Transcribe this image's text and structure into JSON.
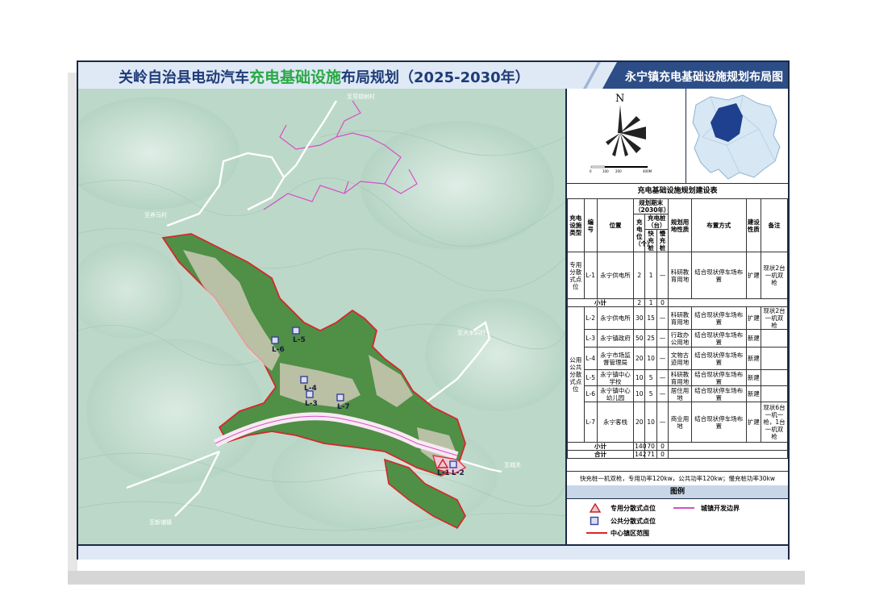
{
  "header": {
    "title_pre": "关岭自治县电动汽车",
    "title_highlight": "充电基础设施",
    "title_post": "布局规划（2025-2030年）",
    "subtitle": "永宁镇充电基础设施规划布局图"
  },
  "map": {
    "road_labels": [
      "至弯德树村",
      "至养马村",
      "至大水洞村",
      "至城关",
      "至新铺镇"
    ],
    "points": [
      "L-1",
      "L-2",
      "L-3",
      "L-4",
      "L-5",
      "L-6",
      "L-7"
    ]
  },
  "compass": {
    "north": "N",
    "scale": [
      "0",
      "100",
      "200",
      "400M"
    ]
  },
  "table": {
    "title": "充电基础设施规划建设表",
    "headers": {
      "type": "充电设施类型",
      "id": "编号",
      "location": "位置",
      "period": "规划期末（2030年）",
      "spaces": "充电位（个）",
      "piles": "充电桩（台）",
      "fast": "快充桩",
      "slow": "慢充桩",
      "land": "规划用地性质",
      "layout": "布置方式",
      "nature": "建设性质",
      "remark": "备注"
    },
    "group1": {
      "type": "专用分散式点位",
      "rows": [
        {
          "id": "L-1",
          "location": "永宁供电所",
          "spaces": "2",
          "fast": "1",
          "slow": "—",
          "land": "科研教育用地",
          "layout": "结合现状停车场布置",
          "nature": "扩建",
          "remark": "现状2台一机双枪"
        }
      ],
      "subtotal": {
        "label": "小计",
        "spaces": "2",
        "fast": "1",
        "slow": "0"
      }
    },
    "group2": {
      "type": "公用公共分散式点位",
      "rows": [
        {
          "id": "L-2",
          "location": "永宁供电所",
          "spaces": "30",
          "fast": "15",
          "slow": "—",
          "land": "科研教育用地",
          "layout": "结合现状停车场布置",
          "nature": "扩建",
          "remark": "现状2台一机双枪"
        },
        {
          "id": "L-3",
          "location": "永宁镇政府",
          "spaces": "50",
          "fast": "25",
          "slow": "—",
          "land": "行政办公用地",
          "layout": "结合现状停车场布置",
          "nature": "新建",
          "remark": ""
        },
        {
          "id": "L-4",
          "location": "永宁市场监督管理局",
          "spaces": "20",
          "fast": "10",
          "slow": "—",
          "land": "文物古迹用地",
          "layout": "结合现状停车场布置",
          "nature": "新建",
          "remark": ""
        },
        {
          "id": "L-5",
          "location": "永宁镇中心学校",
          "spaces": "10",
          "fast": "5",
          "slow": "—",
          "land": "科研教育用地",
          "layout": "结合现状停车场布置",
          "nature": "新建",
          "remark": ""
        },
        {
          "id": "L-6",
          "location": "永宁镇中心幼儿园",
          "spaces": "10",
          "fast": "5",
          "slow": "—",
          "land": "居住用地",
          "layout": "结合现状停车场布置",
          "nature": "新建",
          "remark": ""
        },
        {
          "id": "L-7",
          "location": "永宁客栈",
          "spaces": "20",
          "fast": "10",
          "slow": "—",
          "land": "商业用地",
          "layout": "结合现状停车场布置",
          "nature": "扩建",
          "remark": "现状6台一机一枪，1台一机双枪"
        }
      ],
      "subtotal": {
        "label": "小计",
        "spaces": "140",
        "fast": "70",
        "slow": "0"
      }
    },
    "total": {
      "label": "合计",
      "spaces": "142",
      "fast": "71",
      "slow": "0"
    },
    "note": "快充桩一机双枪，专用功率120kw，公共功率120kw；慢充桩功率30kw"
  },
  "legend": {
    "title": "图例",
    "items": [
      "专用分散式点位",
      "城镇开发边界",
      "公共分散式点位",
      "中心镇区范围"
    ]
  },
  "colors": {
    "title": "#1f3b78",
    "highlight": "#2aa845",
    "boundary_red": "#d9252b",
    "boundary_pink": "#d64fc7",
    "terrain": "#b9d6c6",
    "urban": "#3f8a3b"
  }
}
